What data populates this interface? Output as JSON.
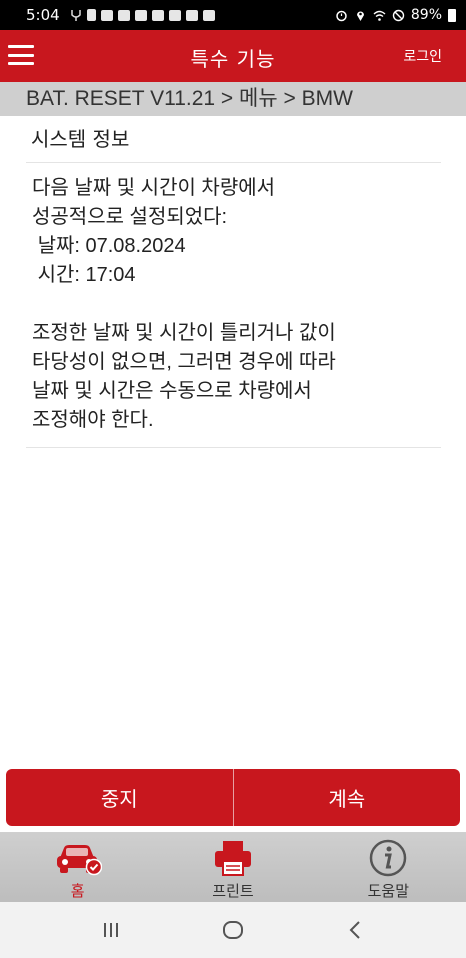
{
  "status_bar": {
    "time": "5:04",
    "battery_text": "89%",
    "icons": [
      "usb-debug-icon",
      "app-icon",
      "image-icon",
      "notification-icon",
      "alarm-icon",
      "location-icon",
      "wifi-icon",
      "dnd-icon",
      "battery-icon"
    ]
  },
  "header": {
    "title": "특수 기능",
    "login_label": "로그인"
  },
  "breadcrumb": {
    "text": "BAT. RESET V11.21 > 메뉴 > BMW"
  },
  "content": {
    "section_title": "시스템 정보",
    "message": "다음 날짜 및 시간이 차량에서\n성공적으로 설정되었다:\n 날짜: 07.08.2024\n 시간: 17:04\n\n조정한 날짜 및 시간이 틀리거나 값이\n타당성이 없으면, 그러면 경우에 따라\n날짜 및 시간은 수동으로 차량에서\n조정해야 한다."
  },
  "actions": {
    "stop_label": "중지",
    "continue_label": "계속"
  },
  "bottom_nav": {
    "items": [
      {
        "label": "홈",
        "icon": "car-check-icon"
      },
      {
        "label": "프린트",
        "icon": "printer-icon"
      },
      {
        "label": "도움말",
        "icon": "info-icon"
      }
    ]
  },
  "colors": {
    "brand_red": "#c8171e",
    "breadcrumb_bg": "#cfcfcf",
    "nav_bg": "#c4c4c4"
  }
}
